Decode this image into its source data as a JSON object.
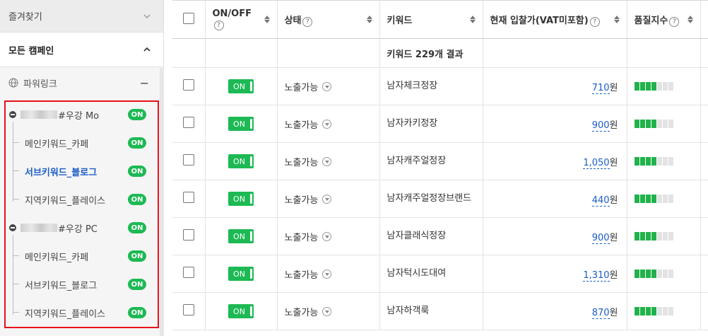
{
  "sidebar": {
    "favorites_label": "즐겨찾기",
    "all_campaigns_label": "모든 캠페인",
    "powerlink_label": "파워링크",
    "powerlink_collapse": "−",
    "campaigns": [
      {
        "name": "#우강 Mo",
        "status": "ON",
        "groups": [
          {
            "label": "메인키워드_카페",
            "status": "ON",
            "active": false
          },
          {
            "label": "서브키워드_블로그",
            "status": "ON",
            "active": true
          },
          {
            "label": "지역키워드_플레이스",
            "status": "ON",
            "active": false
          }
        ]
      },
      {
        "name": "#우강 PC",
        "status": "ON",
        "groups": [
          {
            "label": "메인키워드_카페",
            "status": "ON",
            "active": false
          },
          {
            "label": "서브키워드_블로그",
            "status": "ON",
            "active": false
          },
          {
            "label": "지역키워드_플레이스",
            "status": "ON",
            "active": false
          }
        ]
      }
    ]
  },
  "table": {
    "headers": {
      "onoff": "ON/OFF",
      "status": "상태",
      "keyword": "키워드",
      "bid": "현재 입찰가(VAT미포함)",
      "quality": "품질지수"
    },
    "help_glyph": "?",
    "summary": "키워드 229개 결과",
    "rows": [
      {
        "toggle": "ON",
        "status": "노출가능",
        "keyword": "남자체크정장",
        "bid": "710",
        "unit": "원",
        "quality": 4
      },
      {
        "toggle": "ON",
        "status": "노출가능",
        "keyword": "남자카키정장",
        "bid": "900",
        "unit": "원",
        "quality": 4
      },
      {
        "toggle": "ON",
        "status": "노출가능",
        "keyword": "남자캐주얼정장",
        "bid": "1,050",
        "unit": "원",
        "quality": 4
      },
      {
        "toggle": "ON",
        "status": "노출가능",
        "keyword": "남자캐주얼정장브랜드",
        "bid": "440",
        "unit": "원",
        "quality": 4
      },
      {
        "toggle": "ON",
        "status": "노출가능",
        "keyword": "남자클래식정장",
        "bid": "900",
        "unit": "원",
        "quality": 4
      },
      {
        "toggle": "ON",
        "status": "노출가능",
        "keyword": "남자턱시도대여",
        "bid": "1,310",
        "unit": "원",
        "quality": 4
      },
      {
        "toggle": "ON",
        "status": "노출가능",
        "keyword": "남자하객룩",
        "bid": "870",
        "unit": "원",
        "quality": 4
      }
    ],
    "quality_max": 7
  },
  "colors": {
    "on_green": "#1db954",
    "highlight_red": "#e8101c",
    "link_blue": "#1a5dc8"
  }
}
